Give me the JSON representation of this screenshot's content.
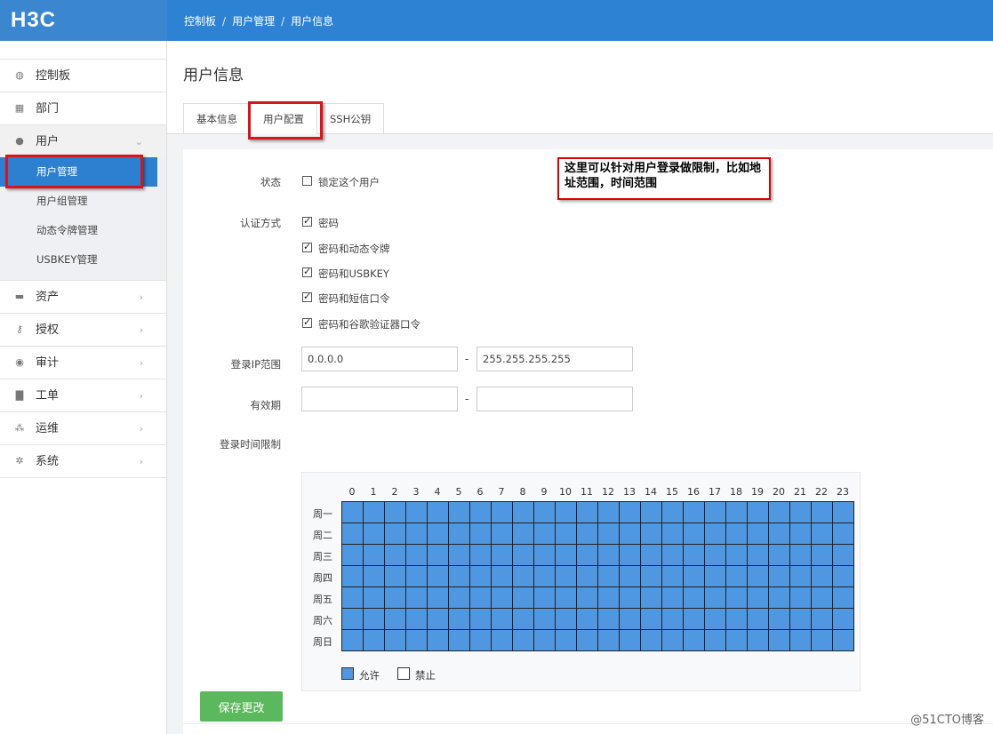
{
  "app": {
    "logo": "H3C"
  },
  "breadcrumb": [
    "控制板",
    "用户管理",
    "用户信息"
  ],
  "breadcrumb_sep": "/",
  "sidebar": {
    "items": [
      {
        "label": "控制板",
        "icon": "dashboard-icon",
        "glyph": "◍",
        "chevron": ""
      },
      {
        "label": "部门",
        "icon": "grid-icon",
        "glyph": "▦",
        "chevron": ""
      },
      {
        "label": "用户",
        "icon": "user-icon",
        "glyph": "●",
        "chevron": "⌄"
      }
    ],
    "submenu": [
      "用户管理",
      "用户组管理",
      "动态令牌管理",
      "USBKEY管理"
    ],
    "items_after": [
      {
        "label": "资产",
        "icon": "server-icon",
        "glyph": "▬",
        "chevron": "›"
      },
      {
        "label": "授权",
        "icon": "key-icon",
        "glyph": "⚷",
        "chevron": "›"
      },
      {
        "label": "审计",
        "icon": "eye-icon",
        "glyph": "◉",
        "chevron": "›"
      },
      {
        "label": "工单",
        "icon": "file-icon",
        "glyph": "▇",
        "chevron": "›"
      },
      {
        "label": "运维",
        "icon": "sitemap-icon",
        "glyph": "⁂",
        "chevron": "›"
      },
      {
        "label": "系统",
        "icon": "gear-icon",
        "glyph": "✲",
        "chevron": "›"
      }
    ]
  },
  "page": {
    "title": "用户信息"
  },
  "tabs": [
    "基本信息",
    "用户配置",
    "SSH公钥"
  ],
  "form": {
    "status_label": "状态",
    "lock_label": "锁定这个用户",
    "auth_label": "认证方式",
    "auth_options": [
      {
        "label": "密码",
        "checked": true
      },
      {
        "label": "密码和动态令牌",
        "checked": true
      },
      {
        "label": "密码和USBKEY",
        "checked": true
      },
      {
        "label": "密码和短信口令",
        "checked": true
      },
      {
        "label": "密码和谷歌验证器口令",
        "checked": true
      }
    ],
    "ip_label": "登录IP范围",
    "ip_start": "0.0.0.0",
    "ip_end": "255.255.255.255",
    "validity_label": "有效期",
    "validity_start": "",
    "validity_end": "",
    "range_sep": "-",
    "time_label": "登录时间限制"
  },
  "time_grid": {
    "hours": [
      "0",
      "1",
      "2",
      "3",
      "4",
      "5",
      "6",
      "7",
      "8",
      "9",
      "10",
      "11",
      "12",
      "13",
      "14",
      "15",
      "16",
      "17",
      "18",
      "19",
      "20",
      "21",
      "22",
      "23"
    ],
    "days": [
      "周一",
      "周二",
      "周三",
      "周四",
      "周五",
      "周六",
      "周日"
    ],
    "all_allowed": true,
    "allow_color": "#4f97e0",
    "legend_allow": "允许",
    "legend_deny": "禁止"
  },
  "save_label": "保存更改",
  "annotation": "这里可以针对用户登录做限制，比如地址范围，时间范围",
  "watermark": "@51CTO博客",
  "colors": {
    "topbar": "#2e82d4",
    "active": "#2d7fcf",
    "save": "#5cb85c",
    "highlight": "#d9141b"
  }
}
